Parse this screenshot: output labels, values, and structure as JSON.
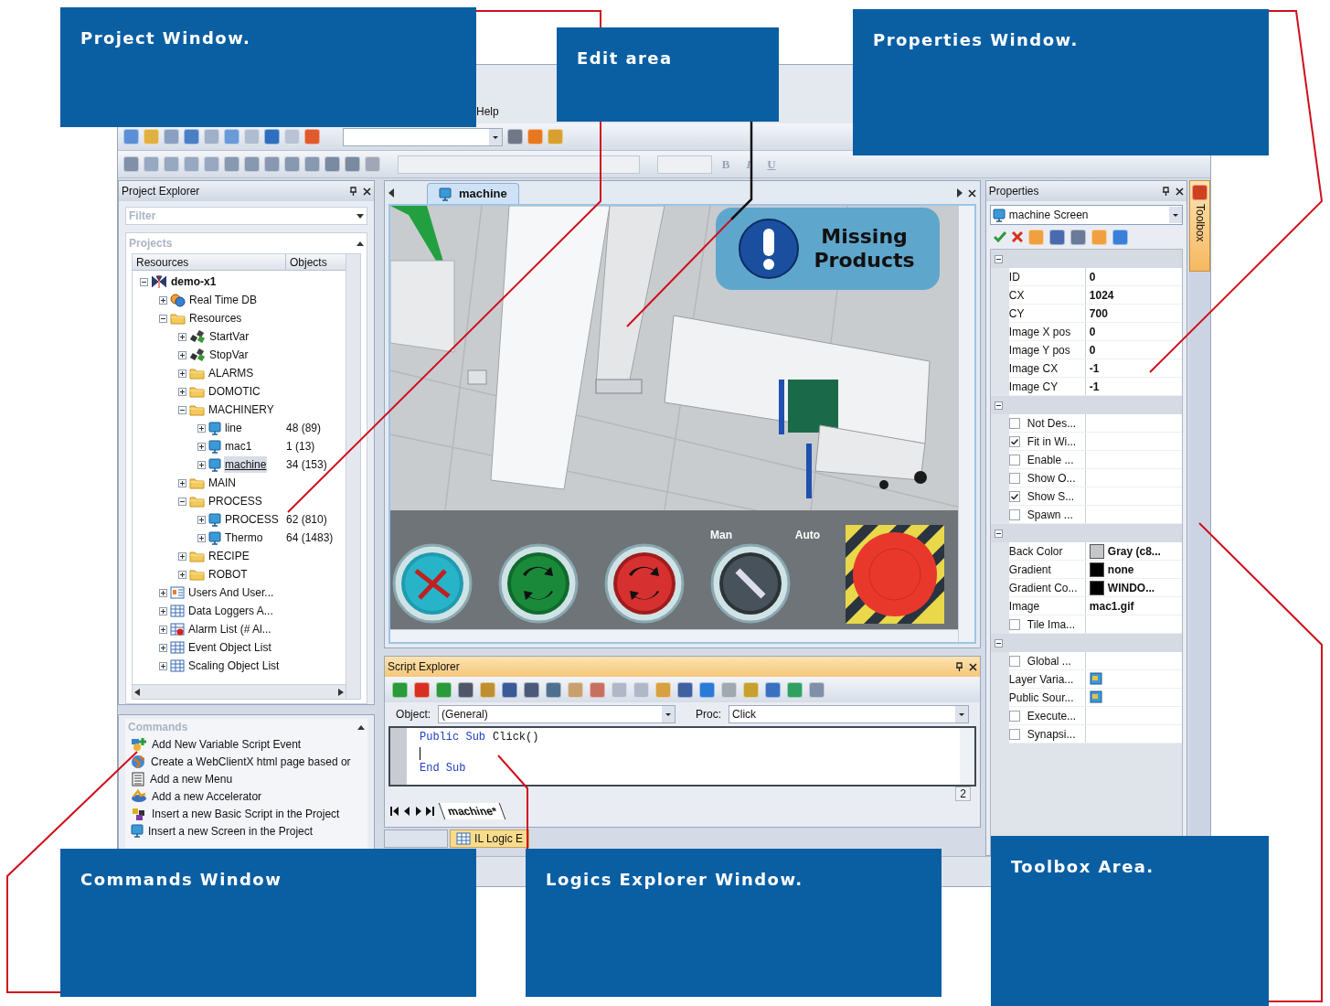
{
  "callouts": [
    {
      "text": "Project Window."
    },
    {
      "text": "Edit area"
    },
    {
      "text": "Properties Window."
    },
    {
      "text": "Commands Window"
    },
    {
      "text": "Logics Explorer Window."
    },
    {
      "text": "Toolbox Area."
    }
  ],
  "menu": [
    {
      "label": "Help"
    }
  ],
  "toolbar": {
    "format_buttons": [
      "B",
      "I",
      "U"
    ]
  },
  "project_explorer": {
    "title": "Project Explorer",
    "filter": {
      "placeholder": "Filter"
    },
    "section": "Projects",
    "columns": [
      "Resources",
      "Objects"
    ],
    "tree": [
      {
        "label": "demo-x1",
        "kind": "project",
        "expanded": true,
        "selected": false,
        "children": [
          {
            "label": "Real Time DB",
            "kind": "database",
            "expanded": false,
            "selected": false
          },
          {
            "label": "Resources",
            "kind": "folder",
            "expanded": true,
            "selected": false,
            "children": [
              {
                "label": "StartVar",
                "kind": "variable",
                "expanded": false,
                "selected": false
              },
              {
                "label": "StopVar",
                "kind": "variable",
                "expanded": false,
                "selected": false
              },
              {
                "label": "ALARMS",
                "kind": "folder",
                "expanded": false,
                "selected": false
              },
              {
                "label": "DOMOTIC",
                "kind": "folder",
                "expanded": false,
                "selected": false
              },
              {
                "label": "MACHINERY",
                "kind": "folder",
                "expanded": true,
                "selected": false,
                "children": [
                  {
                    "label": "line",
                    "kind": "screen",
                    "objects": "48 (89)",
                    "expanded": false,
                    "selected": false
                  },
                  {
                    "label": "mac1",
                    "kind": "screen",
                    "objects": "1 (13)",
                    "expanded": false,
                    "selected": false
                  },
                  {
                    "label": "machine",
                    "kind": "screen",
                    "objects": "34 (153)",
                    "expanded": false,
                    "selected": true
                  }
                ]
              },
              {
                "label": "MAIN",
                "kind": "folder",
                "expanded": false,
                "selected": false
              },
              {
                "label": "PROCESS",
                "kind": "folder",
                "expanded": true,
                "selected": false,
                "children": [
                  {
                    "label": "PROCESS",
                    "kind": "screen",
                    "objects": "62 (810)",
                    "expanded": false,
                    "selected": false
                  },
                  {
                    "label": "Thermo",
                    "kind": "screen",
                    "objects": "64 (1483)",
                    "expanded": false,
                    "selected": false
                  }
                ]
              },
              {
                "label": "RECIPE",
                "kind": "folder",
                "expanded": false,
                "selected": false
              },
              {
                "label": "ROBOT",
                "kind": "folder",
                "expanded": false,
                "selected": false
              }
            ]
          },
          {
            "label": "Users And User...",
            "kind": "users",
            "expanded": false,
            "selected": false
          },
          {
            "label": "Data Loggers A...",
            "kind": "list",
            "expanded": false,
            "selected": false
          },
          {
            "label": "Alarm List (# Al...",
            "kind": "alarm",
            "expanded": false,
            "selected": false
          },
          {
            "label": "Event Object List",
            "kind": "list",
            "expanded": false,
            "selected": false
          },
          {
            "label": "Scaling Object List",
            "kind": "list",
            "expanded": false,
            "selected": false
          }
        ]
      }
    ]
  },
  "commands": {
    "title": "Commands",
    "items": [
      {
        "label": "Add New Variable Script Event",
        "kind": "event"
      },
      {
        "label": "Create a WebClientX html page based or",
        "kind": "web"
      },
      {
        "label": "Add a new Menu",
        "kind": "menu"
      },
      {
        "label": "Add a new Accelerator",
        "kind": "accelerator"
      },
      {
        "label": "Insert a new Basic Script in the Project",
        "kind": "script"
      },
      {
        "label": "Insert a new Screen in the Project",
        "kind": "screen"
      }
    ]
  },
  "editor": {
    "tabs": [
      {
        "label": "machine",
        "selected": true
      }
    ],
    "hmi": {
      "message": "Missing Products",
      "switch_labels": [
        "Man",
        "Auto"
      ],
      "auto_mode": false
    }
  },
  "script_explorer": {
    "title": "Script Explorer",
    "object": {
      "label": "Object:",
      "value": "(General)"
    },
    "proc": {
      "label": "Proc:",
      "value": "Click"
    },
    "code": [
      {
        "kind": "code",
        "tokens": [
          {
            "text": "Public Sub",
            "kind": "keyword"
          },
          {
            "text": "Click()",
            "kind": "plain"
          }
        ]
      },
      {
        "kind": "cursor"
      },
      {
        "kind": "code",
        "tokens": [
          {
            "text": "End Sub",
            "kind": "keyword"
          }
        ]
      }
    ],
    "page": "2",
    "sheets": [
      {
        "label": "machine*",
        "selected": true
      }
    ]
  },
  "bottom_tabs": [
    {
      "label": "IL Logic E",
      "selected": true
    }
  ],
  "properties": {
    "title": "Properties",
    "object": "machine Screen",
    "sections": [
      {
        "expanded": true,
        "rows": [
          {
            "kind": "value",
            "name": "ID",
            "value": "0"
          },
          {
            "kind": "value",
            "name": "CX",
            "value": "1024"
          },
          {
            "kind": "value",
            "name": "CY",
            "value": "700"
          },
          {
            "kind": "value",
            "name": "Image X pos",
            "value": "0"
          },
          {
            "kind": "value",
            "name": "Image Y pos",
            "value": "0"
          },
          {
            "kind": "value",
            "name": "Image CX",
            "value": "-1"
          },
          {
            "kind": "value",
            "name": "Image CY",
            "value": "-1"
          }
        ]
      },
      {
        "expanded": true,
        "rows": [
          {
            "kind": "check",
            "name": "Not Des...",
            "checked": false
          },
          {
            "kind": "check",
            "name": "Fit in Wi...",
            "checked": true
          },
          {
            "kind": "check",
            "name": "Enable ...",
            "checked": false
          },
          {
            "kind": "check",
            "name": "Show O...",
            "checked": false
          },
          {
            "kind": "check",
            "name": "Show S...",
            "checked": true
          },
          {
            "kind": "check",
            "name": "Spawn ...",
            "checked": false
          }
        ]
      },
      {
        "expanded": true,
        "rows": [
          {
            "kind": "color",
            "name": "Back Color",
            "color": "#c4c8c8",
            "value": "Gray (c8..."
          },
          {
            "kind": "color",
            "name": "Gradient",
            "color": "#000000",
            "value": "none"
          },
          {
            "kind": "color",
            "name": "Gradient Co...",
            "color": "#000000",
            "value": "WINDO..."
          },
          {
            "kind": "value",
            "name": "Image",
            "value": "mac1.gif"
          },
          {
            "kind": "check",
            "name": "Tile Ima...",
            "checked": false
          }
        ]
      },
      {
        "expanded": true,
        "rows": [
          {
            "kind": "check",
            "name": "Global ...",
            "checked": false
          },
          {
            "kind": "icon",
            "name": "Layer Varia..."
          },
          {
            "kind": "icon",
            "name": "Public Sour..."
          },
          {
            "kind": "check",
            "name": "Execute...",
            "checked": false
          },
          {
            "kind": "check",
            "name": "Synapsi...",
            "checked": false
          }
        ]
      }
    ]
  },
  "toolbox": {
    "label": "Toolbox"
  }
}
